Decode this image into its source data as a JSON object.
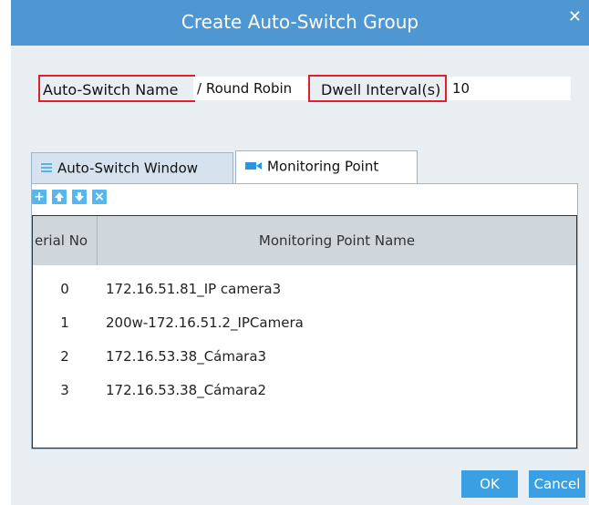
{
  "dialog": {
    "title": "Create Auto-Switch Group"
  },
  "form": {
    "name_label": "Auto-Switch Name",
    "name_value": "/ Round Robin",
    "dwell_label": "Dwell Interval(s)",
    "dwell_value": "10"
  },
  "tabs": [
    {
      "label": "Auto-Switch Window",
      "icon": "grid-icon"
    },
    {
      "label": "Monitoring Point",
      "icon": "camera-icon"
    }
  ],
  "toolbar": [
    "add-icon",
    "move-up-icon",
    "move-down-icon",
    "delete-icon"
  ],
  "grid": {
    "columns": [
      "erial No",
      "Monitoring Point Name"
    ],
    "rows": [
      {
        "serial": "0",
        "name": "172.16.51.81_IP camera3"
      },
      {
        "serial": "1",
        "name": "200w-172.16.51.2_IPCamera"
      },
      {
        "serial": "2",
        "name": "172.16.53.38_Cámara3"
      },
      {
        "serial": "3",
        "name": "172.16.53.38_Cámara2"
      }
    ]
  },
  "buttons": {
    "ok": "OK",
    "cancel": "Cancel"
  },
  "colors": {
    "titlebar": "#4f97d3",
    "highlight": "#e0212b",
    "button": "#3aa0e3"
  }
}
